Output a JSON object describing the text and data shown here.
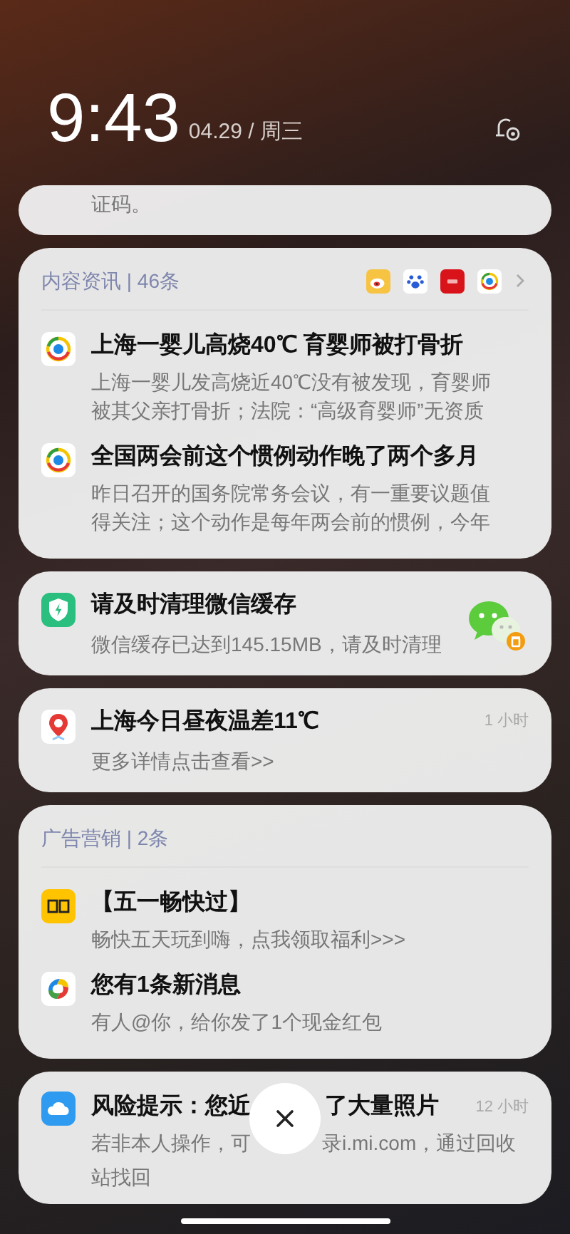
{
  "clock": {
    "time": "9:43",
    "date": "04.29 / 周三"
  },
  "cards": [
    {
      "kind": "stub",
      "body": "证码。"
    },
    {
      "kind": "group",
      "header": "内容资讯 | 46条",
      "items": [
        {
          "title": "上海一婴儿高烧40℃ 育婴师被打骨折",
          "body": "上海一婴儿发高烧近40℃没有被发现，育婴师被其父亲打骨折；法院：“高级育婴师”无资质"
        },
        {
          "title": "全国两会前这个惯例动作晚了两个多月",
          "body": "昨日召开的国务院常务会议，有一重要议题值得关注；这个动作是每年两会前的惯例，今年"
        }
      ]
    },
    {
      "kind": "single",
      "title": "请及时清理微信缓存",
      "body": "微信缓存已达到145.15MB，请及时清理"
    },
    {
      "kind": "single",
      "title": "上海今日昼夜温差11℃",
      "time": "1 小时",
      "body": "更多详情点击查看>>"
    },
    {
      "kind": "group",
      "header": "广告营销 | 2条",
      "items": [
        {
          "title": "【五一畅快过】",
          "body": "畅快五天玩到嗨，点我领取福利>>>"
        },
        {
          "title": "您有1条新消息",
          "body": "有人@你，给你发了1个现金红包"
        }
      ]
    },
    {
      "kind": "covered",
      "title_before": "风险提示：您近",
      "title_after": "了大量照片",
      "time": "12 小时",
      "body_before": "若非本人操作，可",
      "body_after": "录i.mi.com，通过回收",
      "body_line2": "站找回"
    }
  ]
}
